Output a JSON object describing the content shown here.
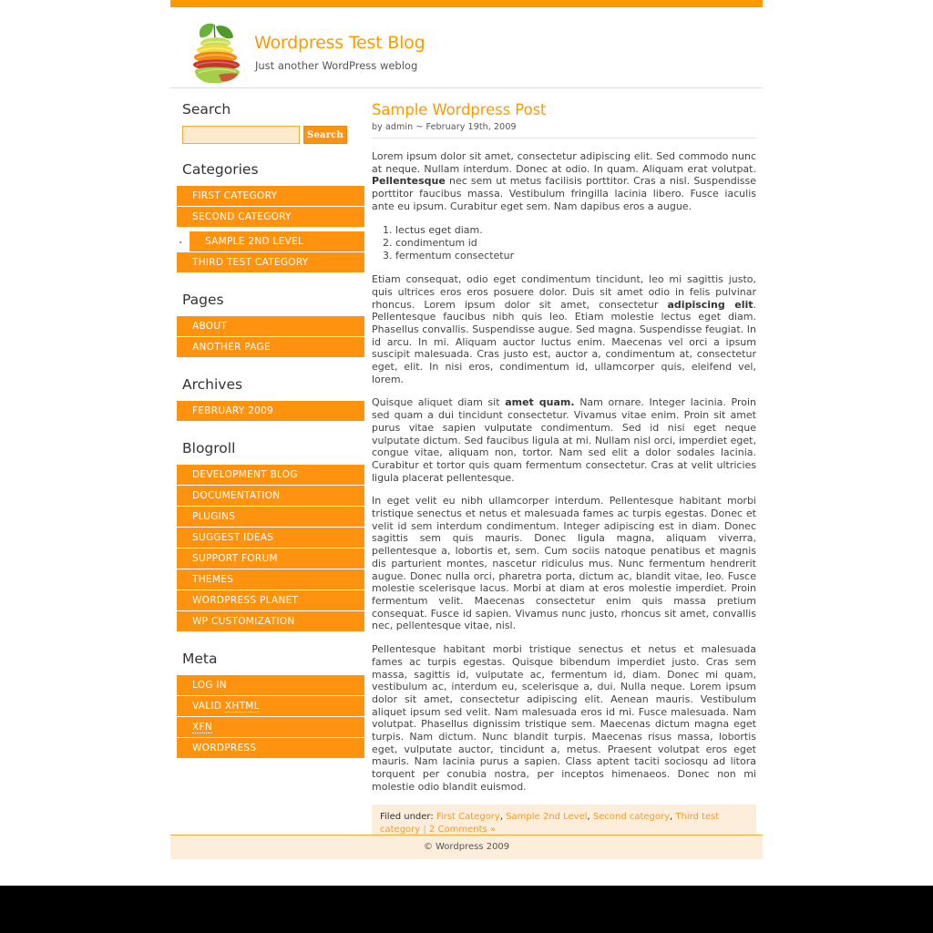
{
  "site": {
    "title": "Wordpress Test Blog",
    "tagline": "Just another WordPress weblog",
    "logo_icon": "fruit-stack-logo-icon",
    "accent_color": "#ff9900",
    "button_color": "#ff9310",
    "panel_color": "#fdeedb"
  },
  "sidebar": {
    "search": {
      "heading": "Search",
      "value": "",
      "placeholder": "",
      "button_label": "Search"
    },
    "categories": {
      "heading": "Categories",
      "items": [
        {
          "label": "First Category",
          "children": []
        },
        {
          "label": "Second Category",
          "children": [
            {
              "label": "Sample 2nd Level"
            }
          ]
        },
        {
          "label": "Third test category",
          "children": []
        }
      ]
    },
    "pages": {
      "heading": "Pages",
      "items": [
        {
          "label": "About"
        },
        {
          "label": "Another Page"
        }
      ]
    },
    "archives": {
      "heading": "Archives",
      "items": [
        {
          "label": "February 2009"
        }
      ]
    },
    "blogroll": {
      "heading": "Blogroll",
      "items": [
        {
          "label": "Development Blog"
        },
        {
          "label": "Documentation"
        },
        {
          "label": "Plugins"
        },
        {
          "label": "Suggest Ideas"
        },
        {
          "label": "Support Forum"
        },
        {
          "label": "Themes"
        },
        {
          "label": "WordPress Planet"
        },
        {
          "label": "WP Customization"
        }
      ]
    },
    "meta": {
      "heading": "Meta",
      "items": [
        {
          "label": "Log in",
          "abbr": ""
        },
        {
          "label": "Valid ",
          "abbr": "XHTML"
        },
        {
          "label": "",
          "abbr": "XFN"
        },
        {
          "label": "WordPress",
          "abbr": ""
        }
      ]
    }
  },
  "post": {
    "title": "Sample Wordpress Post",
    "meta": "by admin ~ February 19th, 2009",
    "paragraph_1_a": "Lorem ipsum dolor sit amet, consectetur adipiscing elit. Sed commodo nunc at neque. Nullam interdum. Donec at odio. In quam. Aliquam erat volutpat. ",
    "paragraph_1_bold": "Pellentesque",
    "paragraph_1_b": " nec sem ut metus facilisis porttitor. Cras a nisl. Suspendisse porttitor faucibus massa. Vestibulum fringilla lacinia libero. Fusce iaculis ante eu ipsum. Curabitur eget sem. Nam dapibus eros a augue.",
    "list_items": [
      "lectus eget diam.",
      "condimentum id",
      "fermentum consectetur"
    ],
    "paragraph_2_a": "Etiam consequat, odio eget condimentum tincidunt, leo mi sagittis justo, quis ultrices eros eros posuere dolor. Duis sit amet odio in felis pulvinar rhoncus. Lorem ipsum dolor sit amet, consectetur ",
    "paragraph_2_bold": "adipiscing elit",
    "paragraph_2_b": ". Pellentesque faucibus nibh quis leo. Etiam molestie lectus eget diam. Phasellus convallis. Suspendisse augue. Sed magna. Suspendisse feugiat. In id arcu. In mi. Aliquam auctor luctus enim. Maecenas vel orci a ipsum suscipit malesuada. Cras justo est, auctor a, condimentum at, consectetur eget, elit. In nisi eros, condimentum id, ullamcorper quis, eleifend vel, lorem.",
    "paragraph_3_a": "Quisque aliquet diam sit ",
    "paragraph_3_bold": "amet quam.",
    "paragraph_3_b": " Nam ornare. Integer lacinia. Proin sed quam a dui tincidunt consectetur. Vivamus vitae enim. Proin sit amet purus vitae sapien vulputate condimentum. Sed id nisi eget neque vulputate dictum. Sed faucibus ligula at mi. Nullam nisl orci, imperdiet eget, congue vitae, aliquam non, tortor. Nam sed elit a dolor sodales lacinia. Curabitur et tortor quis quam fermentum consectetur. Cras at velit ultricies ligula placerat pellentesque.",
    "paragraph_4": "In eget velit eu nibh ullamcorper interdum. Pellentesque habitant morbi tristique senectus et netus et malesuada fames ac turpis egestas. Donec et velit id sem interdum condimentum. Integer adipiscing est in diam. Donec sagittis sem quis mauris. Donec ligula magna, aliquam viverra, pellentesque a, lobortis et, sem. Cum sociis natoque penatibus et magnis dis parturient montes, nascetur ridiculus mus. Nunc fermentum hendrerit augue. Donec nulla orci, pharetra porta, dictum ac, blandit vitae, leo. Fusce molestie scelerisque lacus. Morbi at diam at eros molestie imperdiet. Proin fermentum velit. Maecenas consectetur enim quis massa pretium consequat. Fusce id sapien. Vivamus nunc justo, rhoncus sit amet, convallis nec, pellentesque vitae, nisl.",
    "paragraph_5": "Pellentesque habitant morbi tristique senectus et netus et malesuada fames ac turpis egestas. Quisque bibendum imperdiet justo. Cras sem massa, sagittis id, vulputate ac, fermentum id, diam. Donec mi quam, vestibulum ac, interdum eu, scelerisque a, dui. Nulla neque. Lorem ipsum dolor sit amet, consectetur adipiscing elit. Aenean mauris. Vestibulum aliquet ipsum sed velit. Nam malesuada eros id mi. Fusce malesuada. Nam volutpat. Phasellus dignissim tristique sem. Maecenas dictum magna eget turpis. Nam dictum. Nunc blandit turpis. Maecenas risus massa, lobortis eget, vulputate auctor, tincidunt a, metus. Praesent volutpat eros eget mauris. Nam lacinia purus a sapien. Class aptent taciti sociosqu ad litora torquent per conubia nostra, per inceptos himenaeos. Donec non mi molestie odio blandit euismod.",
    "filed_under_label": "Filed under:",
    "categories": [
      "First Category",
      "Sample 2nd Level",
      "Second category",
      "Third test category"
    ],
    "comments_link": "2 Comments »"
  },
  "footer": {
    "copyright": "© Wordpress 2009"
  }
}
